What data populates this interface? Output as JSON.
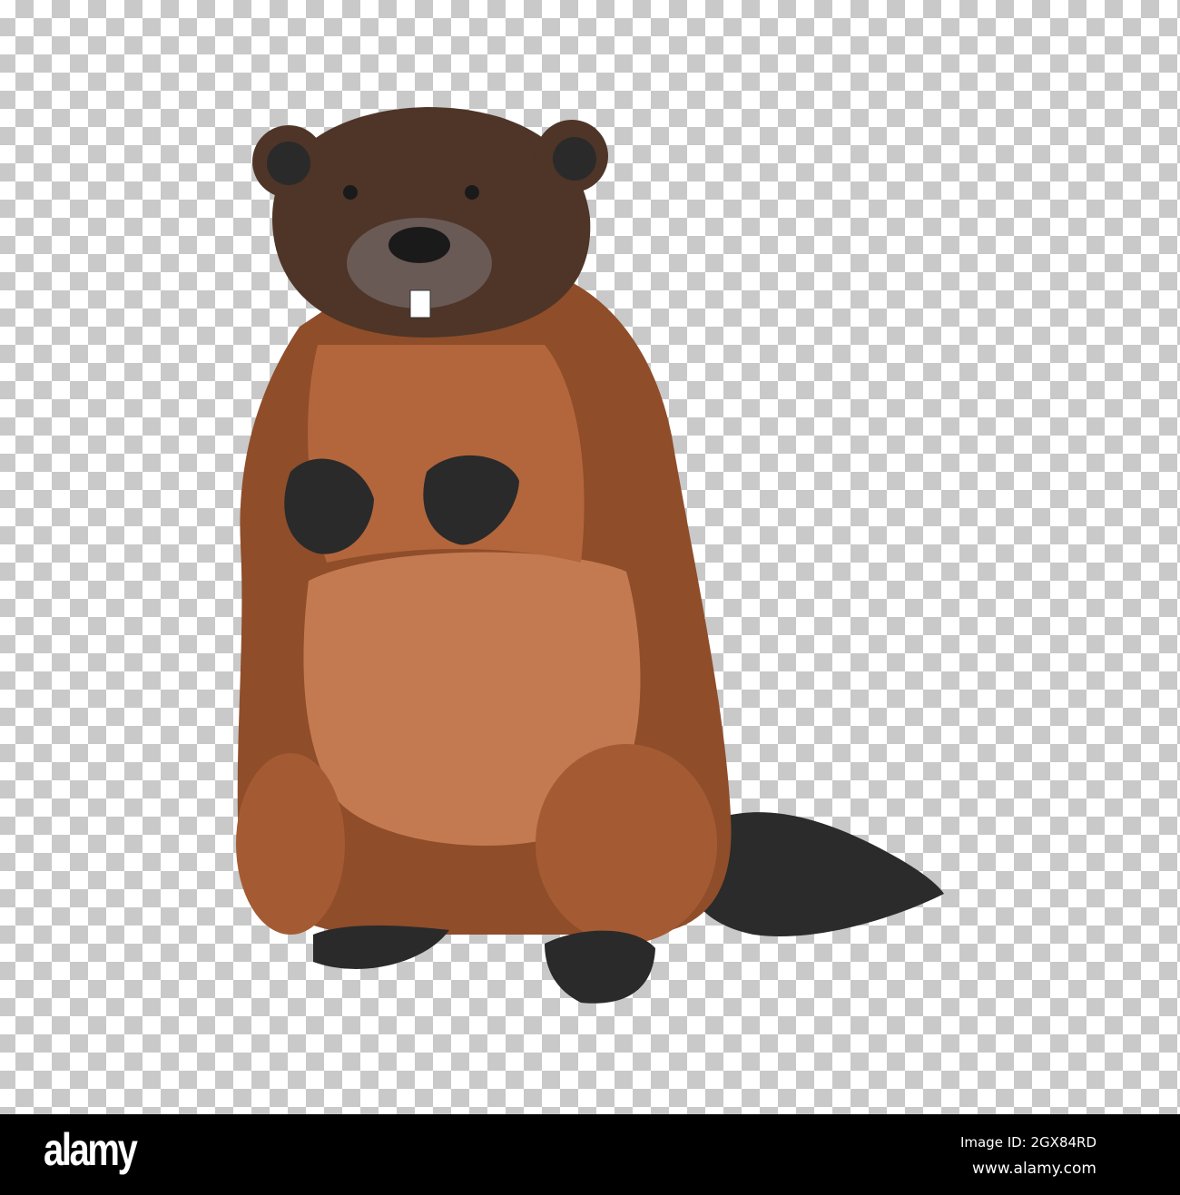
{
  "footer": {
    "logo": "alamy",
    "image_id": "Image ID: 2GX84RD",
    "url": "www.alamy.com"
  },
  "colors": {
    "fur_dark": "#4e3527",
    "fur_body": "#9a5530",
    "belly": "#c57b52",
    "claws": "#2a2a2a"
  }
}
